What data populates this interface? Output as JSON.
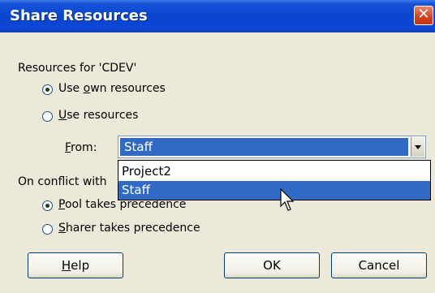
{
  "dialog": {
    "title": "Share Resources",
    "close_symbol": "✕"
  },
  "resources_section": {
    "label": "Resources for 'CDEV'",
    "options": [
      {
        "prefix": "Use ",
        "mnemonic": "o",
        "rest": "wn resources",
        "checked": true
      },
      {
        "prefix": "",
        "mnemonic": "U",
        "rest": "se resources",
        "checked": false
      }
    ]
  },
  "from": {
    "label_mnemonic": "F",
    "label_rest": "rom:",
    "selected_value": "Staff",
    "options": [
      "Project2",
      "Staff"
    ],
    "highlighted_option": "Staff"
  },
  "conflict_section": {
    "label": "On conflict with",
    "options": [
      {
        "prefix": "",
        "mnemonic": "P",
        "rest": "ool takes precedence",
        "checked": true
      },
      {
        "prefix": "",
        "mnemonic": "S",
        "rest": "harer takes precedence",
        "checked": false
      }
    ]
  },
  "buttons": {
    "help_mnemonic": "H",
    "help_rest": "elp",
    "ok": "OK",
    "cancel": "Cancel"
  },
  "colors": {
    "title_bar": "#0a45cf",
    "selection": "#316ac5",
    "dialog_bg": "#ece9d8"
  }
}
